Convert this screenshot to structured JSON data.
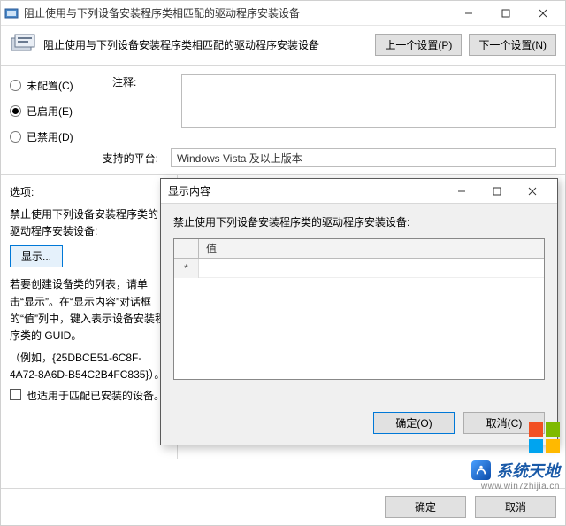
{
  "window": {
    "title": "阻止使用与下列设备安装程序类相匹配的驱动程序安装设备"
  },
  "header": {
    "text": "阻止使用与下列设备安装程序类相匹配的驱动程序安装设备",
    "prev_setting": "上一个设置(P)",
    "next_setting": "下一个设置(N)"
  },
  "radios": {
    "not_configured": "未配置(C)",
    "enabled": "已启用(E)",
    "disabled": "已禁用(D)"
  },
  "labels": {
    "comment": "注释:",
    "supported": "支持的平台:",
    "options": "选项:"
  },
  "fields": {
    "supported_value": "Windows Vista 及以上版本"
  },
  "options": {
    "line1": "禁止使用下列设备安装程序类的驱动程序安装设备:",
    "show_btn": "显示...",
    "line2a": "若要创建设备类的列表，请单击“显示”。在“显示内容”对话框的“值”列中，键入表示设备安装程序类的 GUID。",
    "line3": "（例如，{25DBCE51-6C8F-4A72-8A6D-B54C2B4FC835}）。",
    "checkbox": "也适用于匹配已安装的设备。"
  },
  "footer": {
    "ok": "确定",
    "cancel": "取消"
  },
  "modal": {
    "title": "显示内容",
    "prompt": "禁止使用下列设备安装程序类的驱动程序安装设备:",
    "col_header": "值",
    "row_marker": "*",
    "ok": "确定(O)",
    "cancel": "取消(C)"
  },
  "watermark": {
    "brand": "系统天地",
    "sub": "www.win7zhijia.cn"
  }
}
